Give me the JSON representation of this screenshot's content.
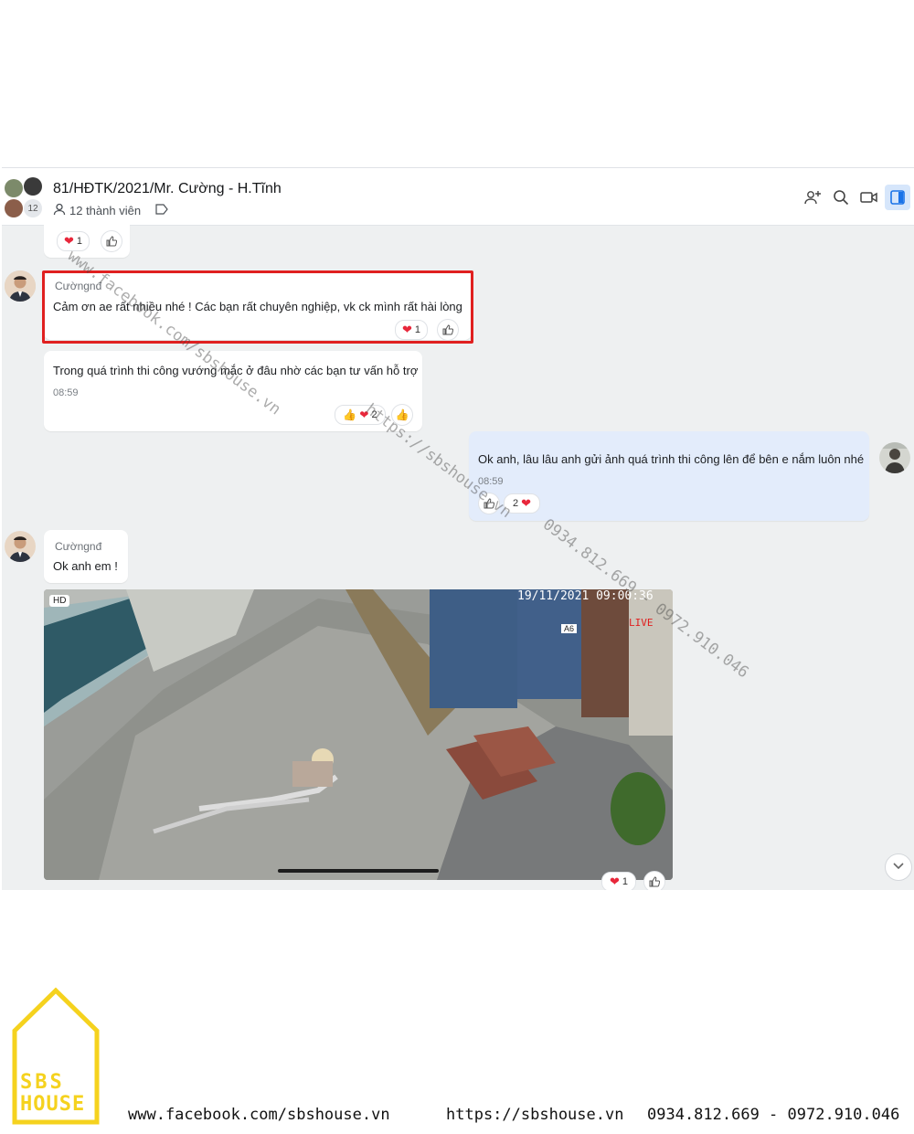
{
  "header": {
    "group_name": "81/HĐTK/2021/Mr. Cường - H.Tĩnh",
    "members": "12 thành viên",
    "avatar_count": "12"
  },
  "messages": [
    {
      "reactions": {
        "heart_count": "1"
      }
    },
    {
      "sender": "Cườngnđ",
      "text": "Cảm ơn ae rất nhiều nhé ! Các bạn rất chuyên nghiệp, vk ck mình rất hài lòng",
      "reactions": {
        "heart_count": "1"
      }
    },
    {
      "text": "Trong quá trình thi công vướng mắc ở đâu nhờ các bạn tư vấn hỗ trợ",
      "time": "08:59",
      "reactions": {
        "count": "2"
      }
    },
    {
      "text": "Ok anh, lâu lâu anh gửi ảnh quá trình thi công lên để bên e nắm luôn nhé",
      "time": "08:59",
      "reactions": {
        "count": "2"
      }
    },
    {
      "sender": "Cườngnđ",
      "text": "Ok anh em !"
    },
    {
      "image": {
        "badge": "HD",
        "timestamp": "19/11/2021 09:00:36",
        "live": "LIVE",
        "container_code": "A6"
      },
      "reactions": {
        "heart_count": "1"
      }
    }
  ],
  "watermarks": [
    "www.facebook.com/sbshouse.vn",
    "https://sbshouse.vn",
    "0934.812.669 - 0972.910.046"
  ],
  "footer": {
    "logo_line1": "SBS",
    "logo_line2": "HOUSE",
    "facebook": "www.facebook.com/sbshouse.vn",
    "website": "https://sbshouse.vn",
    "phones": "0934.812.669 - 0972.910.046"
  },
  "colors": {
    "accent": "#1a73e8",
    "highlight_box": "#e02020",
    "logo": "#f5d21e",
    "heart": "#e8273b"
  },
  "icons": [
    "add-member-icon",
    "search-icon",
    "video-call-icon",
    "panel-toggle-icon",
    "person-icon",
    "tag-icon",
    "heart-icon",
    "thumbs-up-icon",
    "chevron-down-icon"
  ]
}
